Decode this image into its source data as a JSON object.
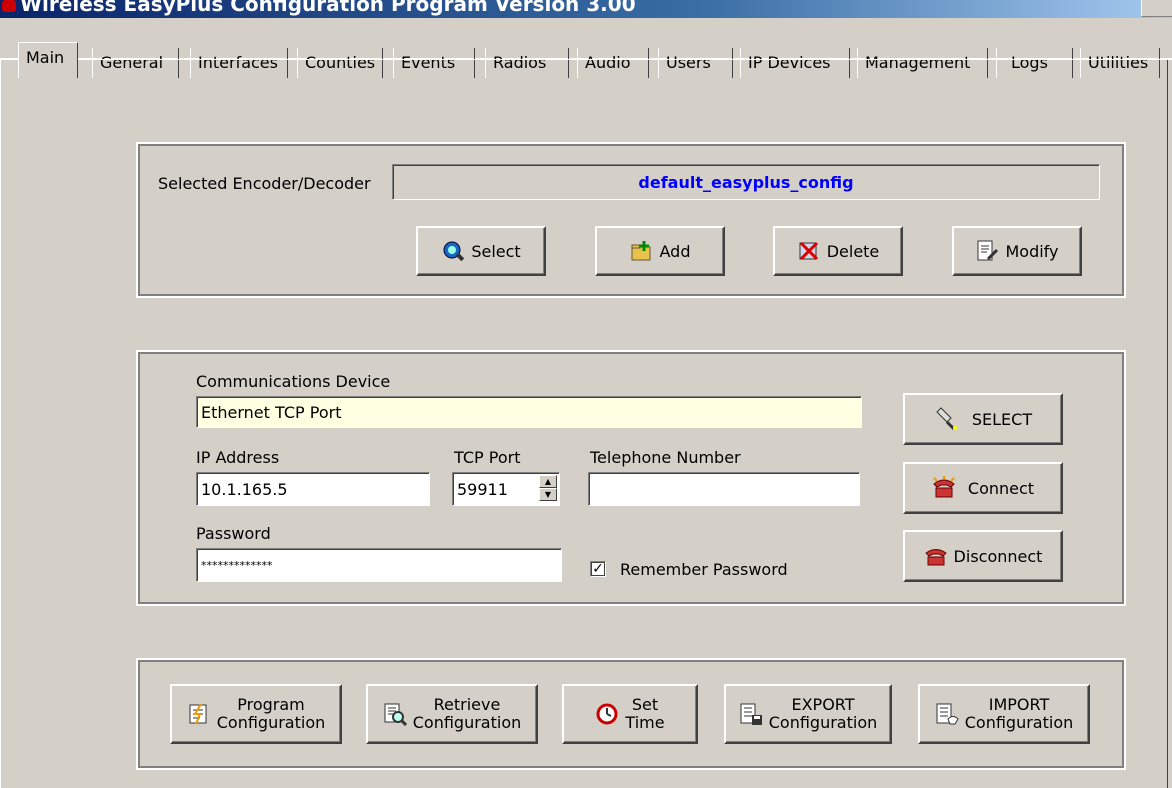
{
  "window": {
    "title": "Wireless EasyPlus Configuration Program Version 3.00"
  },
  "tabs": [
    "Main",
    "General",
    "Interfaces",
    "Counties",
    "Events",
    "Radios",
    "Audio",
    "Users",
    "IP Devices",
    "Management",
    "Logs",
    "Utilities"
  ],
  "active_tab": "Main",
  "encoder": {
    "label": "Selected Encoder/Decoder",
    "value": "default_easyplus_config",
    "value_color": "#0000ff",
    "buttons": {
      "select": "Select",
      "add": "Add",
      "delete": "Delete",
      "modify": "Modify"
    }
  },
  "comm": {
    "device_label": "Communications Device",
    "device_value": "Ethernet TCP Port",
    "ip_label": "IP Address",
    "ip_value": "10.1.165.5",
    "tcp_label": "TCP Port",
    "tcp_value": "59911",
    "phone_label": "Telephone Number",
    "phone_value": "",
    "password_label": "Password",
    "password_value": "*************",
    "remember_label": "Remember Password",
    "remember_checked": true,
    "buttons": {
      "select": "SELECT",
      "connect": "Connect",
      "disconnect": "Disconnect"
    }
  },
  "actions": {
    "program": [
      "Program",
      "Configuration"
    ],
    "retrieve": [
      "Retrieve",
      "Configuration"
    ],
    "settime": [
      "Set",
      "Time"
    ],
    "export": [
      "EXPORT",
      "Configuration"
    ],
    "import": [
      "IMPORT",
      "Configuration"
    ]
  }
}
